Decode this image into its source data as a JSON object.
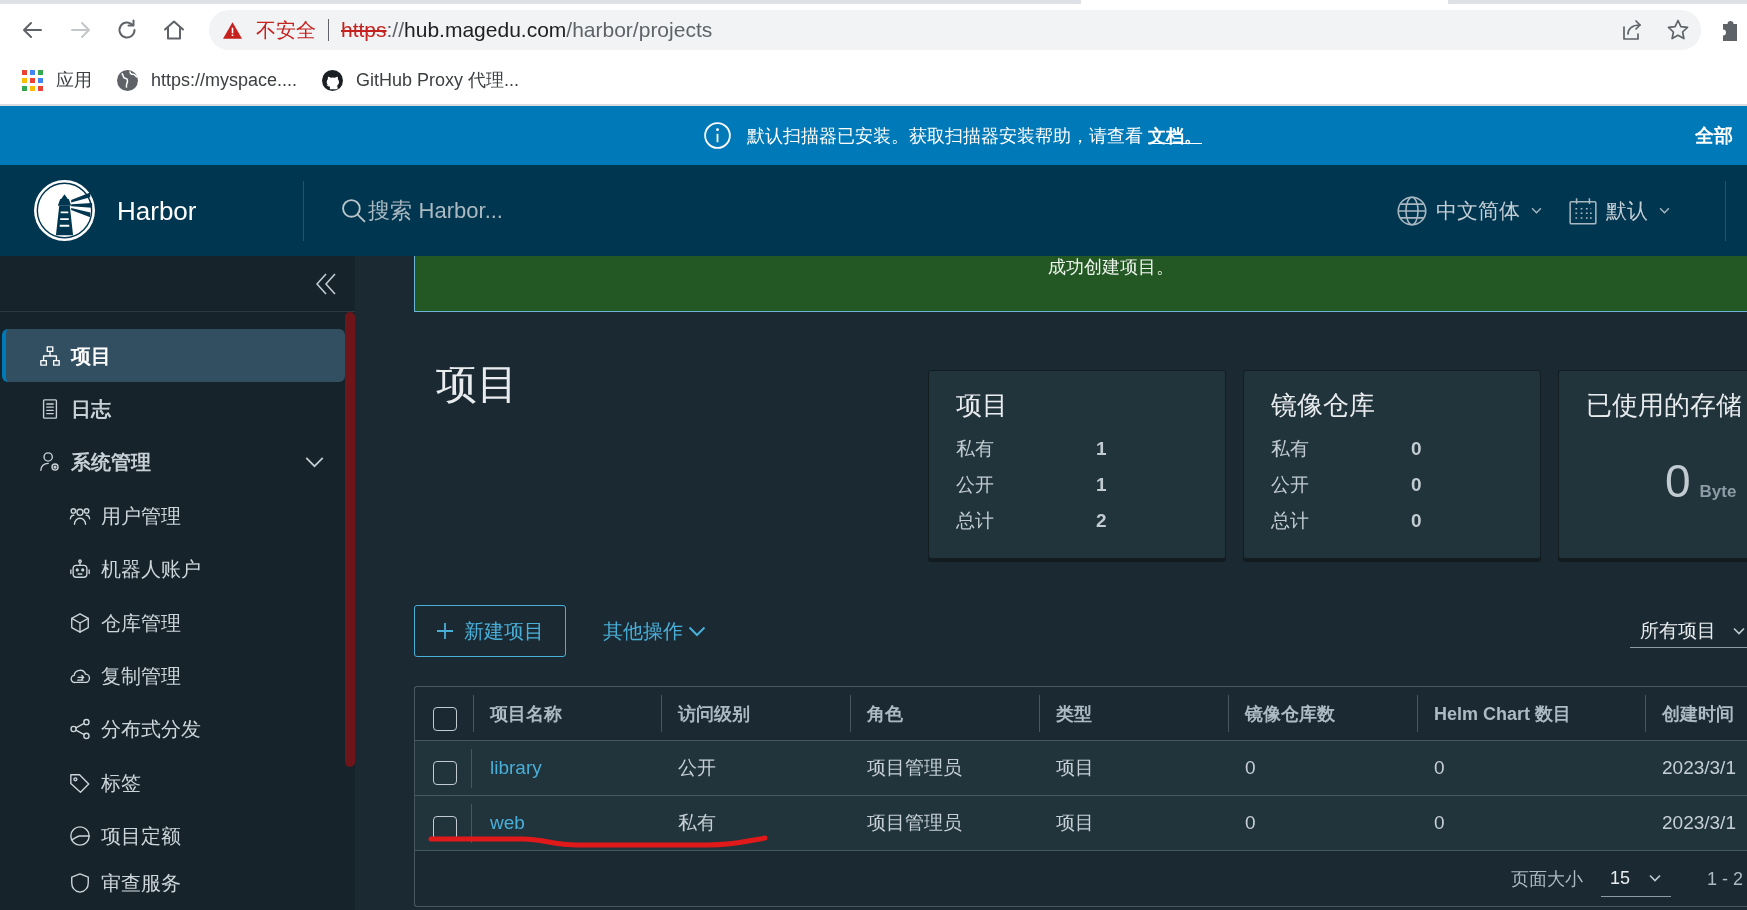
{
  "browser": {
    "nav_buttons": [
      {
        "kind": "back",
        "disabled": false
      },
      {
        "kind": "forward",
        "disabled": true
      },
      {
        "kind": "reload",
        "disabled": false
      },
      {
        "kind": "home",
        "disabled": false
      }
    ],
    "address_bar": {
      "security_label": "不安全",
      "scheme": "https",
      "separator": "://",
      "host": "hub.magedu.com",
      "path": "/harbor/projects"
    },
    "bookmarks": [
      {
        "label": "应用"
      },
      {
        "label": "https://myspace...."
      },
      {
        "label": "GitHub Proxy 代理..."
      }
    ]
  },
  "banner": {
    "message": "默认扫描器已安装。获取扫描器安装帮助，请查看",
    "link": "文档。",
    "action": "全部"
  },
  "header": {
    "title": "Harbor",
    "search": {
      "placeholder": "搜索 Harbor..."
    },
    "language": "中文简体",
    "theme": "默认"
  },
  "sidebar": {
    "items": [
      {
        "label": "项目",
        "selected": true
      },
      {
        "label": "日志",
        "selected": false
      },
      {
        "label": "系统管理",
        "selected": false,
        "expanded": true,
        "children": [
          {
            "label": "用户管理",
            "selected": false
          },
          {
            "label": "机器人账户",
            "selected": false
          },
          {
            "label": "仓库管理",
            "selected": false
          },
          {
            "label": "复制管理",
            "selected": false
          },
          {
            "label": "分布式分发",
            "selected": false
          },
          {
            "label": "标签",
            "selected": false
          },
          {
            "label": "项目定额",
            "selected": false
          },
          {
            "label": "审查服务",
            "selected": false
          }
        ]
      }
    ]
  },
  "alert": {
    "message": "成功创建项目。"
  },
  "page_title": "项目",
  "stats": [
    {
      "kind": "counts",
      "title": "项目",
      "rows": [
        {
          "label": "私有",
          "value": "1"
        },
        {
          "label": "公开",
          "value": "1"
        },
        {
          "label": "总计",
          "value": "2"
        }
      ]
    },
    {
      "kind": "counts",
      "title": "镜像仓库",
      "rows": [
        {
          "label": "私有",
          "value": "0"
        },
        {
          "label": "公开",
          "value": "0"
        },
        {
          "label": "总计",
          "value": "0"
        }
      ]
    },
    {
      "kind": "storage",
      "title": "已使用的存储",
      "value": "0",
      "unit": "Byte"
    }
  ],
  "toolbar": {
    "new_button": "新建项目",
    "more_actions": "其他操作",
    "filter": "所有项目"
  },
  "table": {
    "all_checked": false,
    "columns": [
      "项目名称",
      "访问级别",
      "角色",
      "类型",
      "镜像仓库数",
      "Helm Chart 数目",
      "创建时间"
    ],
    "rows": [
      {
        "selected": false,
        "cells": [
          "library",
          "公开",
          "项目管理员",
          "项目",
          "0",
          "0",
          "2023/3/1"
        ]
      },
      {
        "selected": false,
        "cells": [
          "web",
          "私有",
          "项目管理员",
          "项目",
          "0",
          "0",
          "2023/3/1"
        ]
      }
    ]
  },
  "pagination": {
    "page_size_label": "页面大小",
    "page_size": "15",
    "range": "1 - 2"
  }
}
